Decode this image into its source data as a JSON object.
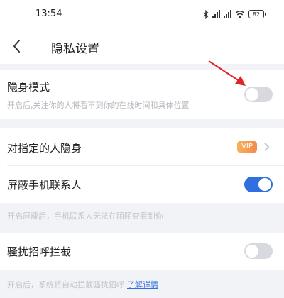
{
  "status_bar": {
    "time": "13:54",
    "battery": "82"
  },
  "header": {
    "title": "隐私设置"
  },
  "invisible_mode": {
    "title": "隐身模式",
    "description": "开启后,关注你的人将看不到你的在线时间和具体位置",
    "enabled": false
  },
  "specific_invisible": {
    "title": "对指定的人隐身",
    "badge": "VIP"
  },
  "block_contacts": {
    "title": "屏蔽手机联系人",
    "enabled": true,
    "note": "开启屏蔽后，手机联系人无法在陌陌查看到你"
  },
  "harass_block": {
    "title": "骚扰招呼拦截",
    "enabled": false,
    "note": "开启后，系统将自动拦截骚扰招呼",
    "learn_more": "了解详情"
  },
  "colors": {
    "accent": "#2f6fe0",
    "annotation_arrow": "#e0242b",
    "vip": "#f39a50"
  },
  "icons": [
    "back-icon",
    "bluetooth-icon",
    "signal-icon",
    "wifi-icon",
    "battery-icon",
    "chevron-right-icon",
    "red-arrow-annotation"
  ]
}
